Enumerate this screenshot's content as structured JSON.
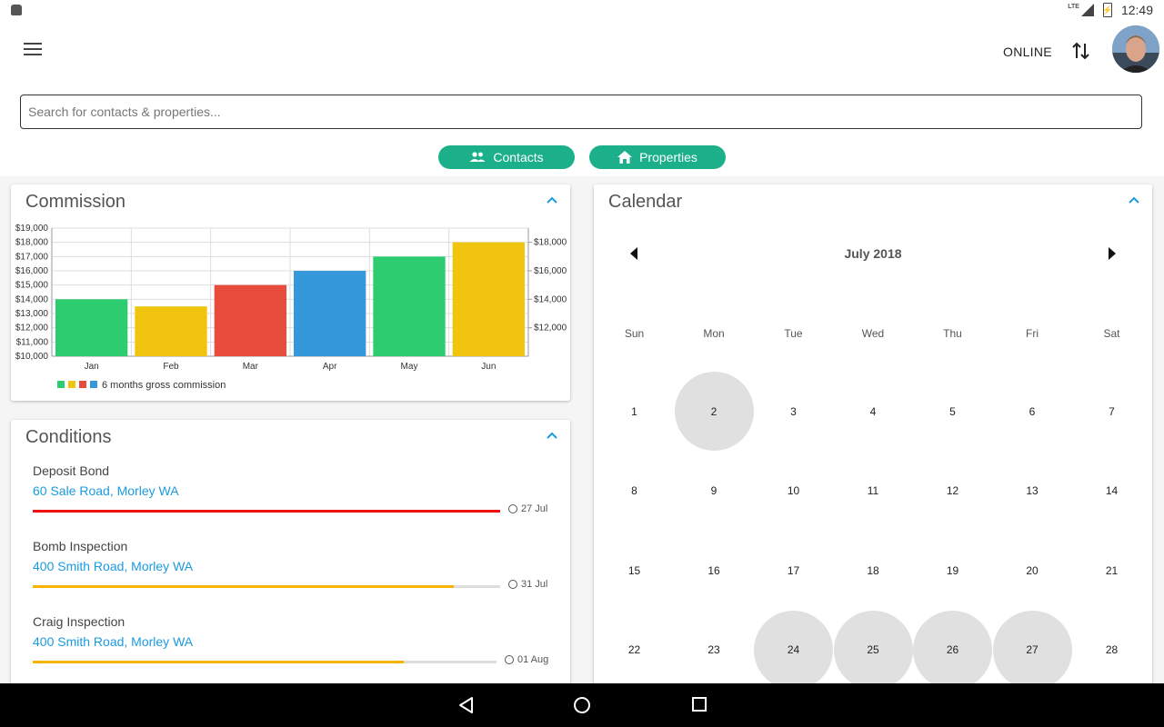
{
  "status_bar": {
    "network": "LTE",
    "battery_level": "bolt",
    "time": "12:49"
  },
  "header": {
    "connection_status": "ONLINE"
  },
  "search": {
    "placeholder": "Search for contacts & properties..."
  },
  "quick_actions": {
    "contacts_label": "Contacts",
    "properties_label": "Properties"
  },
  "colors": {
    "accent": "#1bb08a",
    "link": "#1a9be0",
    "green": "#2ecc71",
    "yellow": "#f1c40f",
    "red": "#e74c3c",
    "blue": "#3498db"
  },
  "commission": {
    "title": "Commission",
    "chart_data": {
      "type": "bar",
      "categories": [
        "Jan",
        "Feb",
        "Mar",
        "Apr",
        "May",
        "Jun"
      ],
      "values": [
        14000,
        13500,
        15000,
        16000,
        17000,
        18000
      ],
      "colors": [
        "#2ecc71",
        "#f1c40f",
        "#e74c3c",
        "#3498db",
        "#2ecc71",
        "#f1c40f"
      ],
      "ylim": [
        10000,
        19000
      ],
      "left_ticks": [
        "$10,000",
        "$11,000",
        "$12,000",
        "$13,000",
        "$14,000",
        "$15,000",
        "$16,000",
        "$17,000",
        "$18,000",
        "$19,000"
      ],
      "right_ticks": [
        "$12,000",
        "$14,000",
        "$16,000",
        "$18,000"
      ],
      "right_tick_values": [
        12000,
        14000,
        16000,
        18000
      ],
      "legend": "6 months gross commission",
      "legend_colors": [
        "#2ecc71",
        "#f1c40f",
        "#e74c3c",
        "#3498db"
      ],
      "grid": true
    }
  },
  "conditions": {
    "title": "Conditions",
    "items": [
      {
        "title": "Deposit Bond",
        "address": "60 Sale Road, Morley WA",
        "date": "27 Jul",
        "progress": 1.0,
        "color": "#ee1111"
      },
      {
        "title": "Bomb Inspection",
        "address": "400 Smith Road, Morley WA",
        "date": "31 Jul",
        "progress": 0.9,
        "color": "#f4b400"
      },
      {
        "title": "Craig Inspection",
        "address": "400 Smith Road, Morley WA",
        "date": "01 Aug",
        "progress": 0.8,
        "color": "#f4b400"
      }
    ]
  },
  "calendar": {
    "title": "Calendar",
    "month": "July 2018",
    "weekdays": [
      "Sun",
      "Mon",
      "Tue",
      "Wed",
      "Thu",
      "Fri",
      "Sat"
    ],
    "weeks": [
      [
        "1",
        "2",
        "3",
        "4",
        "5",
        "6",
        "7"
      ],
      [
        "8",
        "9",
        "10",
        "11",
        "12",
        "13",
        "14"
      ],
      [
        "15",
        "16",
        "17",
        "18",
        "19",
        "20",
        "21"
      ],
      [
        "22",
        "23",
        "24",
        "25",
        "26",
        "27",
        "28"
      ]
    ],
    "highlighted": [
      "2",
      "24",
      "25",
      "26",
      "27"
    ]
  }
}
